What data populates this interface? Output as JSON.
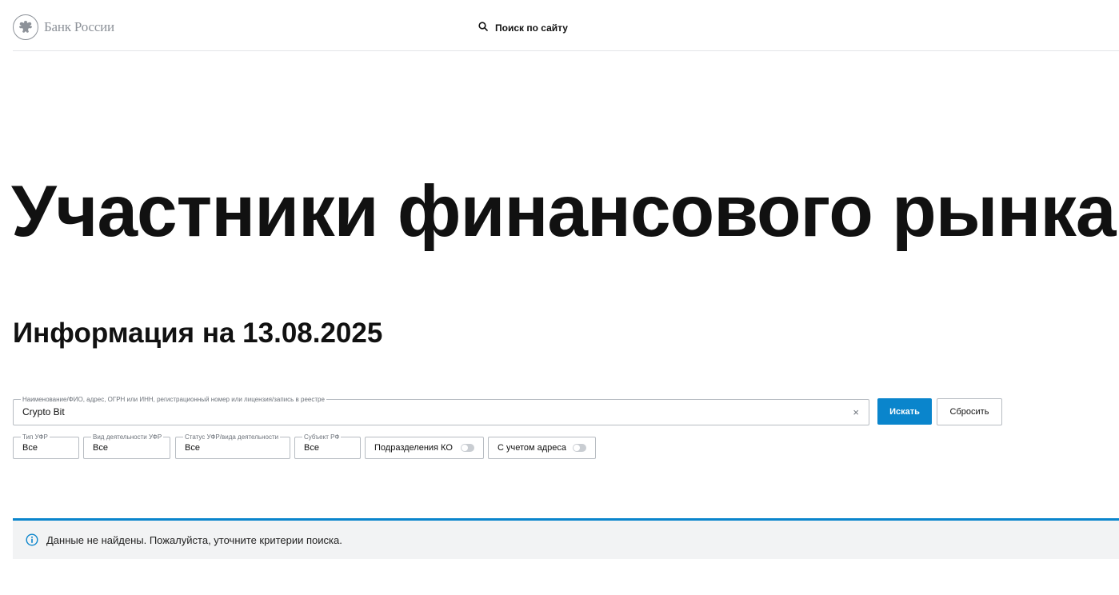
{
  "header": {
    "logo_text": "Банк России",
    "site_search_label": "Поиск по сайту"
  },
  "page": {
    "title": "Участники финансового рынка",
    "subtitle": "Информация на 13.08.2025"
  },
  "search": {
    "legend": "Наименование/ФИО, адрес, ОГРН или ИНН, регистрационный номер или лицензия/запись в реестре",
    "value": "Crypto Bit",
    "clear_label": "×",
    "search_button": "Искать",
    "reset_button": "Сбросить"
  },
  "filters": [
    {
      "legend": "Тип УФР",
      "value": "Все"
    },
    {
      "legend": "Вид деятельности УФР",
      "value": "Все"
    },
    {
      "legend": "Статус УФР/вида деятельности",
      "value": "Все"
    },
    {
      "legend": "Субъект РФ",
      "value": "Все"
    }
  ],
  "toggles": [
    {
      "label": "Подразделения КО",
      "state": "off"
    },
    {
      "label": "С учетом адреса",
      "state": "off"
    }
  ],
  "alert": {
    "icon": "info-icon",
    "text": "Данные не найдены. Пожалуйста, уточните критерии поиска.",
    "accent_color": "#0a85cc"
  },
  "colors": {
    "accent": "#0a85cc",
    "alert_background": "#f2f3f4"
  }
}
